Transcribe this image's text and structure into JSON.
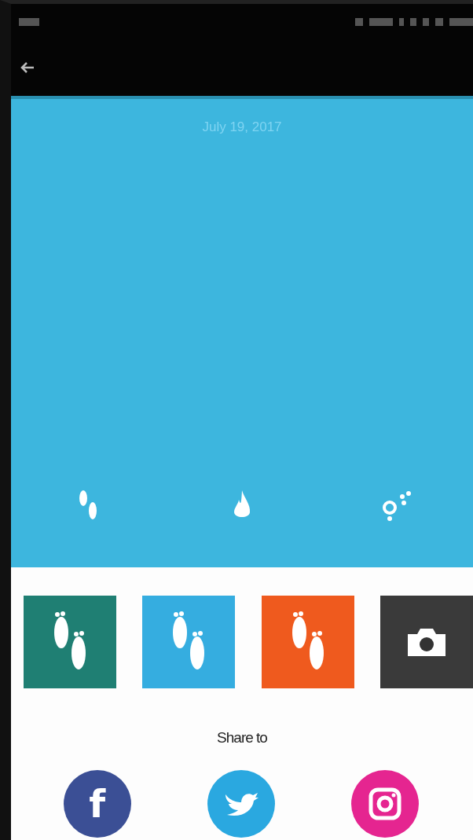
{
  "date": "July 19, 2017",
  "stats": [
    {
      "kind": "steps"
    },
    {
      "kind": "calories"
    },
    {
      "kind": "distance"
    }
  ],
  "themes": [
    {
      "kind": "footprints",
      "color": "#1f7f73"
    },
    {
      "kind": "footprints",
      "color": "#35ade0"
    },
    {
      "kind": "footprints",
      "color": "#ef5a1e"
    },
    {
      "kind": "camera",
      "color": "#3a3a3a"
    }
  ],
  "share_title": "Share to",
  "share": [
    {
      "kind": "letter",
      "label": "f",
      "color": "#3b4f95"
    },
    {
      "kind": "bird",
      "color": "#2aa8e0"
    },
    {
      "kind": "camera",
      "color": "#e52590"
    }
  ]
}
